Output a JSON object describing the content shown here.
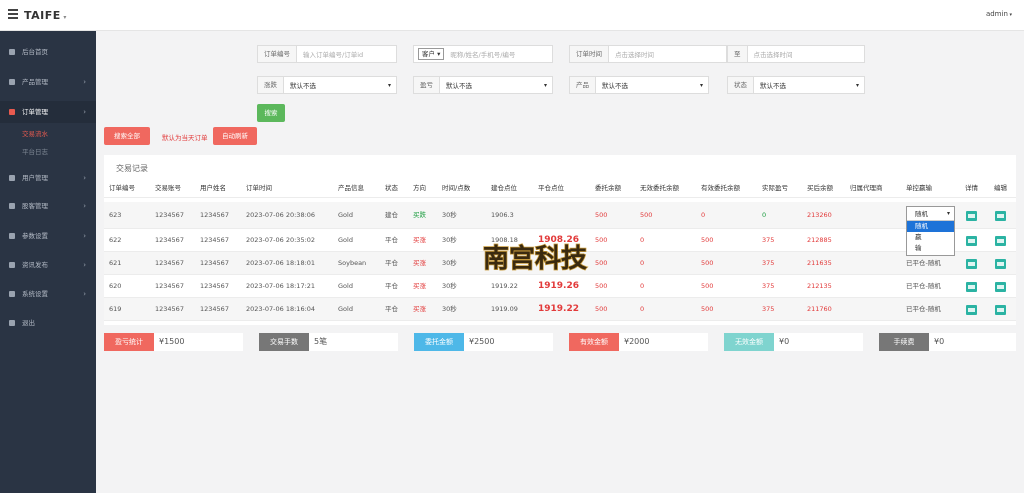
{
  "topbar": {
    "brand": "TAIFE",
    "admin": "admin"
  },
  "sidebar": {
    "items": [
      "后台首页",
      "产品管理",
      "订单管理",
      "用户管理",
      "股客管理",
      "参数设置",
      "资讯发布",
      "系统设置",
      "退出"
    ],
    "sub": [
      "交易流水",
      "平台日志"
    ]
  },
  "filters": {
    "order_no_label": "订单编号",
    "order_no_placeholder": "输入订单编号/订单id",
    "user_select": "客户",
    "user_placeholder": "昵称/姓名/手机号/编号",
    "time_label": "订单时间",
    "time_start_placeholder": "点击选择时间",
    "time_to": "至",
    "time_end_placeholder": "点击选择时间",
    "dir_label": "涨跌",
    "dir_value": "默认不选",
    "pl_label": "盈亏",
    "pl_value": "默认不选",
    "product_label": "产品",
    "product_value": "默认不选",
    "status_label": "状态",
    "status_value": "默认不选",
    "search_btn": "搜索",
    "search_all_btn": "搜索全部",
    "today_note": "默认为当天订单",
    "auto_refresh_btn": "自动刷新"
  },
  "table": {
    "title": "交易记录",
    "headers": [
      "订单编号",
      "交易账号",
      "用户姓名",
      "订单时间",
      "产品信息",
      "状态",
      "方向",
      "时间/点数",
      "建仓点位",
      "平仓点位",
      "委托余额",
      "无效委托余额",
      "有效委托余额",
      "实际盈亏",
      "买后余额",
      "归属代理商",
      "单控赢输",
      "详情",
      "编辑"
    ],
    "rows": [
      {
        "id": "623",
        "acct": "1234567",
        "name": "1234567",
        "time": "2023-07-06 20:38:06",
        "product": "Gold",
        "status": "建仓",
        "dir": "买跌",
        "dur": "30秒",
        "open": "1906.3",
        "close": "",
        "entrust": "500",
        "invalid": "500",
        "valid": "0",
        "pl": "0",
        "after": "213260",
        "agent": "",
        "control": ""
      },
      {
        "id": "622",
        "acct": "1234567",
        "name": "1234567",
        "time": "2023-07-06 20:35:02",
        "product": "Gold",
        "status": "平仓",
        "dir": "买涨",
        "dur": "30秒",
        "open": "1908.18",
        "close": "1908.26",
        "entrust": "500",
        "invalid": "0",
        "valid": "500",
        "pl": "375",
        "after": "212885",
        "agent": "",
        "control": "已平仓-随机"
      },
      {
        "id": "621",
        "acct": "1234567",
        "name": "1234567",
        "time": "2023-07-06 18:18:01",
        "product": "Soybean",
        "status": "平仓",
        "dir": "买涨",
        "dur": "30秒",
        "open": "",
        "close": "",
        "entrust": "500",
        "invalid": "0",
        "valid": "500",
        "pl": "375",
        "after": "211635",
        "agent": "",
        "control": "已平仓-随机"
      },
      {
        "id": "620",
        "acct": "1234567",
        "name": "1234567",
        "time": "2023-07-06 18:17:21",
        "product": "Gold",
        "status": "平仓",
        "dir": "买涨",
        "dur": "30秒",
        "open": "1919.22",
        "close": "1919.26",
        "entrust": "500",
        "invalid": "0",
        "valid": "500",
        "pl": "375",
        "after": "212135",
        "agent": "",
        "control": "已平仓-随机"
      },
      {
        "id": "619",
        "acct": "1234567",
        "name": "1234567",
        "time": "2023-07-06 18:16:04",
        "product": "Gold",
        "status": "平仓",
        "dir": "买涨",
        "dur": "30秒",
        "open": "1919.09",
        "close": "1919.22",
        "entrust": "500",
        "invalid": "0",
        "valid": "500",
        "pl": "375",
        "after": "211760",
        "agent": "",
        "control": "已平仓-随机"
      }
    ],
    "dropdown": {
      "selected": "随机",
      "options": [
        "随机",
        "赢",
        "输"
      ]
    }
  },
  "stats": [
    {
      "label": "盈亏统计",
      "value": "¥1500",
      "color": "#f0685f"
    },
    {
      "label": "交易手数",
      "value": "5笔",
      "color": "#777777"
    },
    {
      "label": "委托金额",
      "value": "¥2500",
      "color": "#4eb8e8"
    },
    {
      "label": "有效金额",
      "value": "¥2000",
      "color": "#f0685f"
    },
    {
      "label": "无效金额",
      "value": "¥0",
      "color": "#7fd4cf"
    },
    {
      "label": "手续费",
      "value": "¥0",
      "color": "#777777"
    }
  ],
  "watermark": "南宫科技",
  "colors": {
    "sidebar": "#2a3444",
    "accent": "#e85a4f",
    "search_btn": "#5cb85c",
    "green_btn": "#2bb3a3"
  }
}
